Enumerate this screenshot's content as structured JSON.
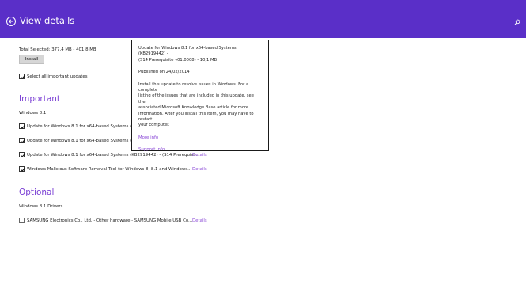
{
  "header": {
    "title": "View details"
  },
  "summary": {
    "total_selected": "Total Selected: 377,4 MB - 401,8 MB",
    "install_label": "Install",
    "select_all_label": "Select all important updates"
  },
  "important": {
    "heading": "Important",
    "group_label": "Windows 8.1",
    "items": [
      {
        "label": "Update for Windows 8.1 for x64-based Systems (KB",
        "details": ""
      },
      {
        "label": "Update for Windows 8.1 for x64-based Systems (KB",
        "details": ""
      },
      {
        "label": "Update for Windows 8.1 for x64-based Systems (KB2919442) - (S14 Prerequisi...",
        "details": "Details"
      },
      {
        "label": "Windows Malicious Software Removal Tool for Windows 8, 8.1 and Windows...",
        "details": "Details"
      }
    ]
  },
  "optional": {
    "heading": "Optional",
    "group_label": "Windows 8.1 Drivers",
    "items": [
      {
        "label": "SAMSUNG Electronics Co., Ltd. - Other hardware - SAMSUNG Mobile USB Co...",
        "details": "Details"
      }
    ]
  },
  "popup": {
    "title_line1": "Update for Windows 8.1 for x64-based Systems (KB2919442) -",
    "title_line2": "(S14 Prerequisite v01.0008) - 10,1 MB",
    "published": "Published on 24/02/2014",
    "desc_line1": "Install this update to resolve issues in Windows. For a complete",
    "desc_line2": "listing of the issues that are included in this update, see the",
    "desc_line3": "associated Microsoft Knowledge Base article for more",
    "desc_line4": "information. After you install this item, you may have to restart",
    "desc_line5": "your computer.",
    "more_info": "More info",
    "support_info": "Support info"
  }
}
